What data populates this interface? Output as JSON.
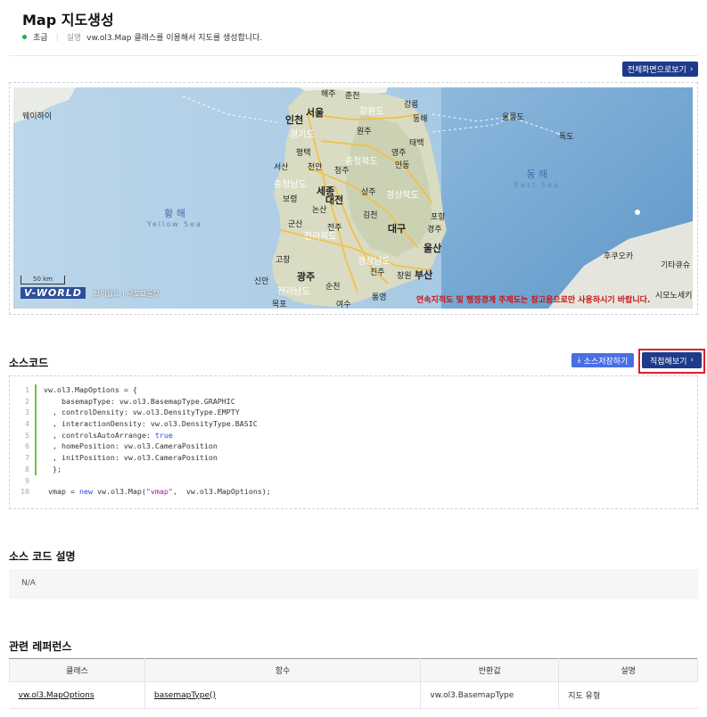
{
  "header": {
    "title": "Map 지도생성",
    "level": "초급",
    "desc_label": "설명",
    "description": "vw.ol3.Map 클래스를 이용해서 지도를 생성합니다."
  },
  "map_panel": {
    "fullscreen_button": "전체화면으로보기",
    "scale_label": "50 km",
    "logo_text": "V-WORLD",
    "logo_sub": "브이월드 | 국토교통부",
    "notice": "연속지적도 및 행정경계 주제도는 참고용으로만 사용하시기 바랍니다.",
    "seas": [
      {
        "ko": "황 해",
        "en": "Yellow Sea"
      },
      {
        "ko": "동 해",
        "en": "East Sea"
      }
    ],
    "labels": {
      "haeju": "해주",
      "weihai": "웨이하이",
      "seoul": "서울",
      "incheon": "인천",
      "gyeonggi": "경기도",
      "gangwon": "강원도",
      "chuncheon": "춘천",
      "gangneung": "강릉",
      "donghae": "동해",
      "wonju": "원주",
      "taebaek": "태백",
      "ulleungdo": "울릉도",
      "dokdo": "독도",
      "chungbuk": "충청북도",
      "chungnam": "충청남도",
      "cheongju": "청주",
      "cheonan": "천안",
      "pyeongtaek": "평택",
      "seosan": "서산",
      "sejong": "세종",
      "daejeon": "대전",
      "boryeong": "보령",
      "nonsan": "논산",
      "sangju": "상주",
      "andong": "안동",
      "yeongju": "영주",
      "gyeongbuk": "경상북도",
      "gimcheon": "김천",
      "daegu": "대구",
      "pohang": "포항",
      "gyeongju": "경주",
      "ulsan": "울산",
      "busan": "부산",
      "changwon": "창원",
      "gyeongnam": "경상남도",
      "jinju": "진주",
      "jeonbuk": "전라북도",
      "gunsan": "군산",
      "jeonju": "전주",
      "gwangju": "광주",
      "jeonnam": "전라남도",
      "mokpo": "목포",
      "suncheon": "순천",
      "yeosu": "여수",
      "tongyeong": "통영",
      "gochang": "고창",
      "sinan": "신안",
      "fukuoka": "후쿠오카",
      "kitakyushu": "기타큐슈",
      "shimonoseki": "시모노세키"
    }
  },
  "source": {
    "heading": "소스코드",
    "save_button": "소스저장하기",
    "try_button": "직접해보기",
    "lines": [
      {
        "n": "1",
        "parts": [
          {
            "t": "vw.ol3.MapOptions = {",
            "c": "txt"
          }
        ]
      },
      {
        "n": "2",
        "parts": [
          {
            "t": "    basemapType: vw.ol3.BasemapType.GRAPHIC",
            "c": "txt"
          }
        ]
      },
      {
        "n": "3",
        "parts": [
          {
            "t": "  , controlDensity: vw.ol3.DensityType.EMPTY",
            "c": "txt"
          }
        ]
      },
      {
        "n": "4",
        "parts": [
          {
            "t": "  , interactionDensity: vw.ol3.DensityType.BASIC",
            "c": "txt"
          }
        ]
      },
      {
        "n": "5",
        "parts": [
          {
            "t": "  , controlsAutoArrange: ",
            "c": "txt"
          },
          {
            "t": "true",
            "c": "kw"
          }
        ]
      },
      {
        "n": "6",
        "parts": [
          {
            "t": "  , homePosition: vw.ol3.CameraPosition",
            "c": "txt"
          }
        ]
      },
      {
        "n": "7",
        "parts": [
          {
            "t": "  , initPosition: vw.ol3.CameraPosition",
            "c": "txt"
          }
        ]
      },
      {
        "n": "8",
        "parts": [
          {
            "t": "  };",
            "c": "txt"
          }
        ]
      },
      {
        "n": "9",
        "parts": [
          {
            "t": "",
            "c": "txt"
          }
        ]
      },
      {
        "n": "10",
        "parts": [
          {
            "t": " vmap = ",
            "c": "txt"
          },
          {
            "t": "new",
            "c": "kw"
          },
          {
            "t": " vw.ol3.Map(",
            "c": "txt"
          },
          {
            "t": "\"vmap\"",
            "c": "str"
          },
          {
            "t": ",  vw.ol3.MapOptions);",
            "c": "txt"
          }
        ]
      }
    ]
  },
  "explain": {
    "heading": "소스 코드 설명",
    "text": "N/A"
  },
  "reference": {
    "heading": "관련 레퍼런스",
    "columns": [
      "클래스",
      "함수",
      "반환값",
      "설명"
    ],
    "rows": [
      [
        "vw.ol3.MapOptions",
        "basemapType()",
        "vw.ol3.BasemapType",
        "지도 유형"
      ]
    ]
  },
  "colors": {
    "primary": "#1e3a8a",
    "secondary": "#4a6fe3",
    "highlight": "#e31e24",
    "level_dot": "#1fae4b"
  }
}
